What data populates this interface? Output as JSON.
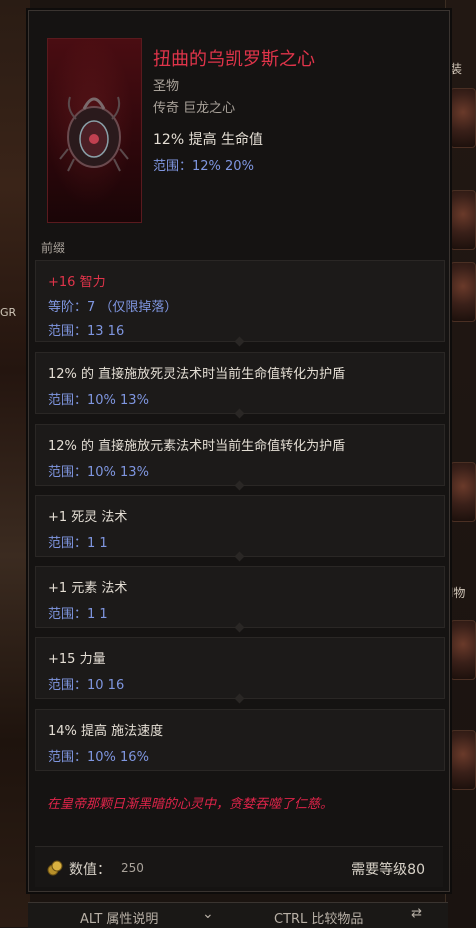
{
  "background": {
    "left_label": "GR",
    "right_labels": [
      "装",
      "l物"
    ]
  },
  "item": {
    "name": "扭曲的乌凯罗斯之心",
    "type": "圣物",
    "rarity": "传奇 巨龙之心",
    "implicit": "12% 提高 生命值",
    "implicit_range": "范围：12%  20%",
    "icon": "heart-relic-icon"
  },
  "section_label": "前缀",
  "affixes": [
    {
      "line1": "+16 智力",
      "line1_color": "red",
      "line_extra": "等阶：7  （仅限掉落）",
      "line2": "范围：13  16"
    },
    {
      "line1": "12% 的 直接施放死灵法术时当前生命值转化为护盾",
      "line2": "范围：10%  13%"
    },
    {
      "line1": "12% 的 直接施放元素法术时当前生命值转化为护盾",
      "line2": "范围：10%  13%"
    },
    {
      "line1": "+1 死灵 法术",
      "line2": "范围：1  1"
    },
    {
      "line1": "+1 元素 法术",
      "line2": "范围：1  1"
    },
    {
      "line1": "+15 力量",
      "line2": "范围：10  16"
    },
    {
      "line1": "14% 提高 施法速度",
      "line2": "范围：10%  16%"
    }
  ],
  "flavor": "在皇帝那颗日渐黑暗的心灵中，贪婪吞噬了仁慈。",
  "footer": {
    "value_label": "数值：",
    "value": "250",
    "requirement": "需要等级80"
  },
  "hints": {
    "alt": "ALT 属性说明",
    "ctrl": "CTRL 比较物品"
  },
  "colors": {
    "title": "#e0344a",
    "range": "#7f96e0",
    "flavor": "#e0244a"
  }
}
